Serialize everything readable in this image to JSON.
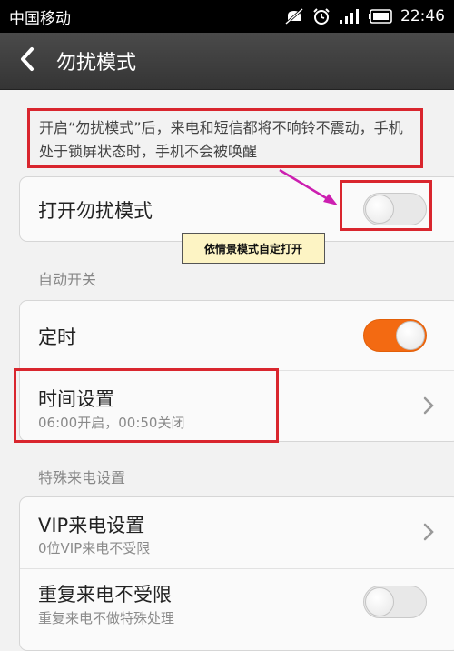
{
  "status_bar": {
    "carrier": "中国移动",
    "time": "22:46",
    "icons": [
      "dnd-icon",
      "alarm-icon",
      "signal-icon",
      "battery-icon"
    ]
  },
  "title_bar": {
    "back_icon": "chevron-left-icon",
    "title": "勿扰模式"
  },
  "description": "开启“勿扰模式”后，来电和短信都将不响铃不震动，手机处于锁屏状态时，手机不会被唤醒",
  "annotation": {
    "callout_text": "依情景模式自定打开",
    "highlight_color": "#d9262e",
    "arrow_color": "#cc1fb0"
  },
  "dnd_card": {
    "label": "打开勿扰模式",
    "enabled": false
  },
  "auto_section": {
    "heading": "自动开关",
    "timer": {
      "label": "定时",
      "enabled": true,
      "toggle_color": "#f36a12"
    },
    "time_setting": {
      "label": "时间设置",
      "sub": "06:00开启，00:50关闭"
    }
  },
  "special_section": {
    "heading": "特殊来电设置",
    "vip": {
      "label": "VIP来电设置",
      "sub": "0位VIP来电不受限"
    },
    "repeat": {
      "label": "重复来电不受限",
      "sub": "重复来电不做特殊处理",
      "enabled": false
    }
  }
}
